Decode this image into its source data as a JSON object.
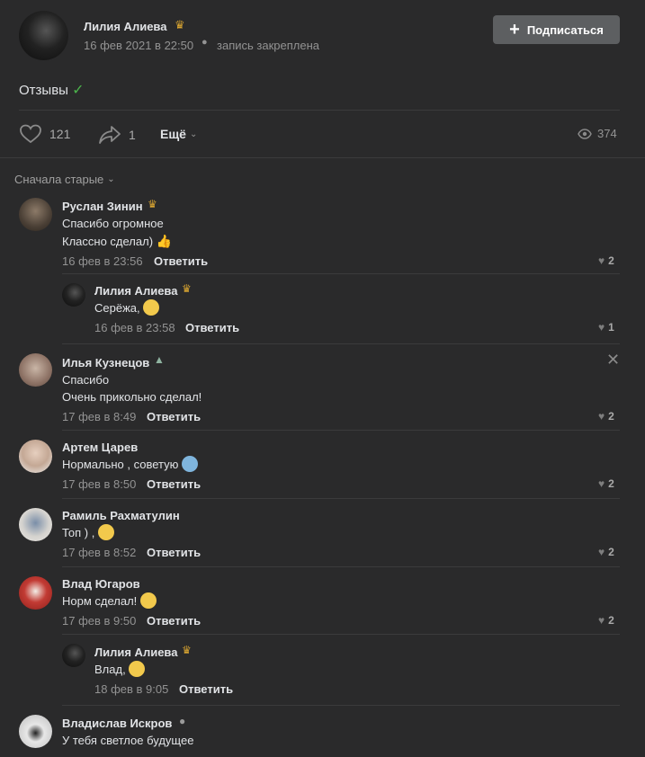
{
  "post": {
    "author": "Лилия Алиева",
    "date": "16 фев 2021 в 22:50",
    "pinned": "запись закреплена",
    "subscribe_label": "Подписаться",
    "text": "Отзывы",
    "likes": "121",
    "shares": "1",
    "more_label": "Ещё",
    "views": "374"
  },
  "sort_label": "Сначала старые",
  "reply_label": "Ответить",
  "comments": [
    {
      "author": "Руслан Зинин",
      "lines": [
        "Спасибо огромное",
        "Классно сделал)"
      ],
      "date": "16 фев в 23:56",
      "likes": "2"
    },
    {
      "author": "Лилия Алиева",
      "lines": [
        "Серёжа,"
      ],
      "date": "16 фев в 23:58",
      "likes": "1"
    },
    {
      "author": "Илья Кузнецов",
      "lines": [
        "Спасибо",
        "Очень прикольно сделал!"
      ],
      "date": "17 фев в 8:49",
      "likes": "2"
    },
    {
      "author": "Артем Царев",
      "lines": [
        "Нормально , советую"
      ],
      "date": "17 фев в 8:50",
      "likes": "2"
    },
    {
      "author": "Рамиль Рахматулин",
      "lines": [
        "Топ ) ,"
      ],
      "date": "17 фев в 8:52",
      "likes": "2"
    },
    {
      "author": "Влад Югаров",
      "lines": [
        "Норм сделал!"
      ],
      "date": "17 фев в 9:50",
      "likes": "2"
    },
    {
      "author": "Лилия Алиева",
      "lines": [
        "Влад,"
      ],
      "date": "18 фев в 9:05",
      "likes": ""
    },
    {
      "author": "Владислав Искров",
      "lines": [
        "У тебя светлое будущее"
      ],
      "date": "",
      "likes": ""
    }
  ],
  "colors": {
    "background": "#2a2a2b",
    "accent_check": "#4bb34b",
    "button_bg": "#5d5f61"
  }
}
